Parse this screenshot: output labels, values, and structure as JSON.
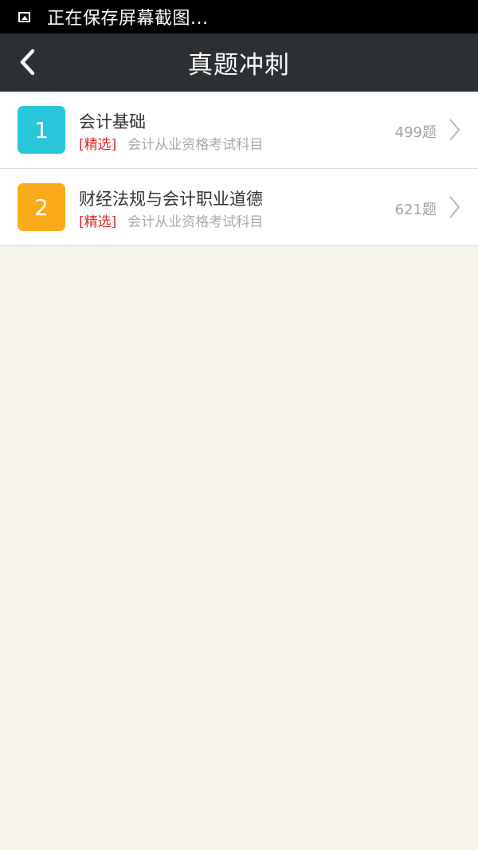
{
  "status_bar": {
    "icon": "screenshot-image-icon",
    "text": "正在保存屏幕截图..."
  },
  "header": {
    "back_icon": "back-arrow-icon",
    "title": "真题冲刺"
  },
  "items": [
    {
      "number": "1",
      "badge_color": "#29c6da",
      "title": "会计基础",
      "tag": "[精选]",
      "description": "会计从业资格考试科目",
      "count": "499题"
    },
    {
      "number": "2",
      "badge_color": "#fbab19",
      "title": "财经法规与会计职业道德",
      "tag": "[精选]",
      "description": "会计从业资格考试科目",
      "count": "621题"
    }
  ],
  "colors": {
    "status_bar": "#000000",
    "title_bar": "#2d3032",
    "background": "#f5f3ec",
    "tag": "#e5242a"
  }
}
